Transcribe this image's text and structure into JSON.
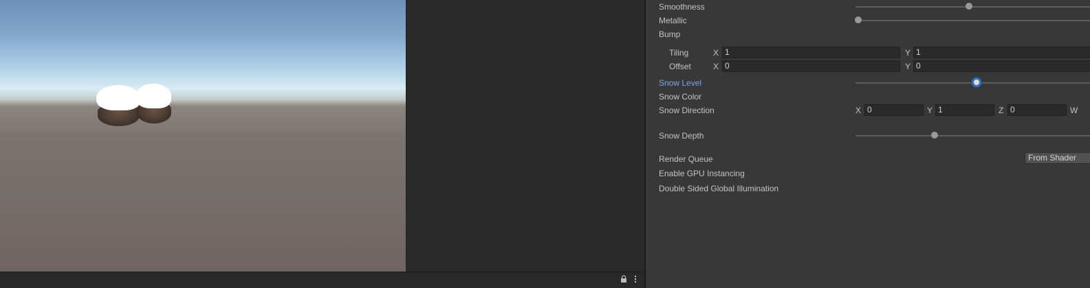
{
  "inspector": {
    "smoothness_label": "Smoothness",
    "smoothness_value": 0.5,
    "metallic_label": "Metallic",
    "metallic_value": 0.0,
    "bump_label": "Bump",
    "tiling_label": "Tiling",
    "tiling_x": "1",
    "tiling_y": "1",
    "offset_label": "Offset",
    "offset_x": "0",
    "offset_y": "0",
    "axis_x": "X",
    "axis_y": "Y",
    "axis_z": "Z",
    "axis_w": "W",
    "snow_level_label": "Snow Level",
    "snow_level_value": 0.55,
    "snow_color_label": "Snow Color",
    "snow_direction_label": "Snow Direction",
    "snow_direction_x": "0",
    "snow_direction_y": "1",
    "snow_direction_z": "0",
    "snow_depth_label": "Snow Depth",
    "snow_depth_value": 0.35,
    "render_queue_label": "Render Queue",
    "render_queue_value": "From Shader",
    "gpu_instancing_label": "Enable GPU Instancing",
    "double_sided_gi_label": "Double Sided Global Illumination"
  },
  "icons": {
    "lock": "lock-icon",
    "more": "more-options-icon"
  },
  "colors": {
    "active_label": "#7aa6e8",
    "slider_focus": "#3b6fb8"
  }
}
